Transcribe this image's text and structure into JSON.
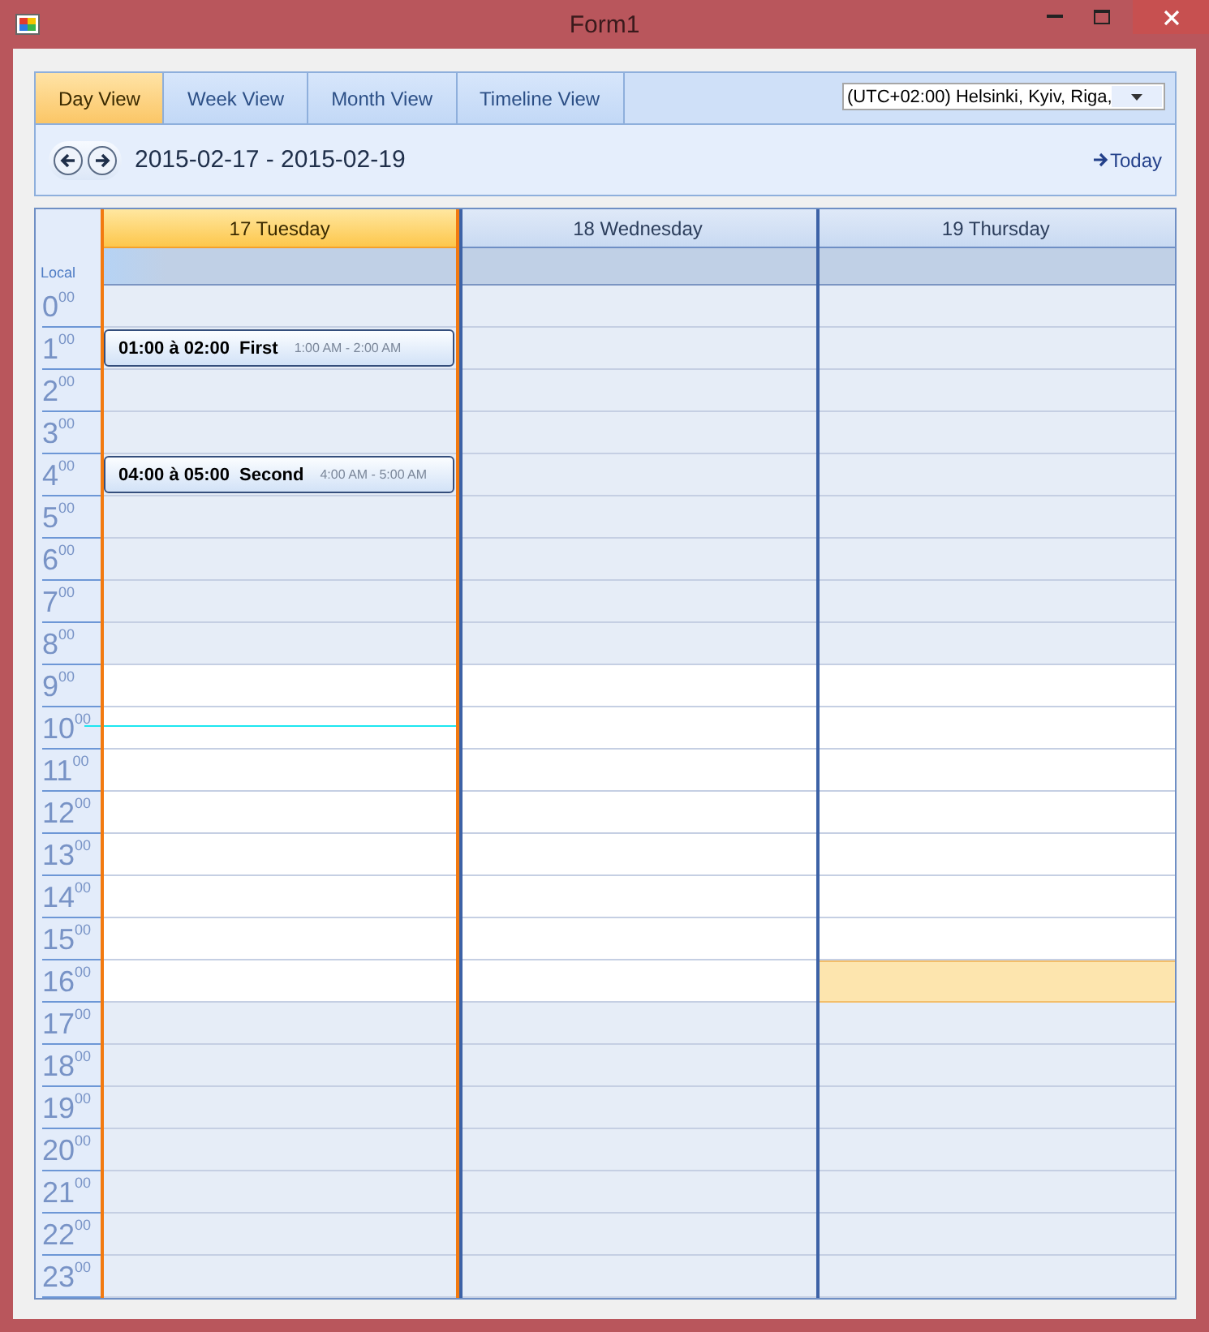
{
  "window": {
    "title": "Form1"
  },
  "tabs": [
    {
      "label": "Day View",
      "selected": true
    },
    {
      "label": "Week View",
      "selected": false
    },
    {
      "label": "Month View",
      "selected": false
    },
    {
      "label": "Timeline View",
      "selected": false
    }
  ],
  "timezone": {
    "value": "(UTC+02:00) Helsinki, Kyiv, Riga,"
  },
  "range": "2015-02-17 - 2015-02-19",
  "today_link": "Today",
  "time_column_label": "Local",
  "days": [
    {
      "label": "17 Tuesday",
      "selected": true,
      "today": true,
      "has_selected_slot": false
    },
    {
      "label": "18 Wednesday",
      "selected": false,
      "today": false,
      "has_selected_slot": false
    },
    {
      "label": "19 Thursday",
      "selected": false,
      "today": false,
      "has_selected_slot": true
    }
  ],
  "hours": [
    {
      "hour": "0",
      "minutes": "00",
      "work_hours": false,
      "now": false,
      "selected": false
    },
    {
      "hour": "1",
      "minutes": "00",
      "work_hours": false,
      "now": false,
      "selected": false,
      "appointments": [
        {
          "time": "01:00 à 02:00",
          "title": "First",
          "range": "1:00 AM - 2:00 AM"
        }
      ]
    },
    {
      "hour": "2",
      "minutes": "00",
      "work_hours": false,
      "now": false,
      "selected": false
    },
    {
      "hour": "3",
      "minutes": "00",
      "work_hours": false,
      "now": false,
      "selected": false
    },
    {
      "hour": "4",
      "minutes": "00",
      "work_hours": false,
      "now": false,
      "selected": false,
      "appointments": [
        {
          "time": "04:00 à 05:00",
          "title": "Second",
          "range": "4:00 AM - 5:00 AM"
        }
      ]
    },
    {
      "hour": "5",
      "minutes": "00",
      "work_hours": false,
      "now": false,
      "selected": false
    },
    {
      "hour": "6",
      "minutes": "00",
      "work_hours": false,
      "now": false,
      "selected": false
    },
    {
      "hour": "7",
      "minutes": "00",
      "work_hours": false,
      "now": false,
      "selected": false
    },
    {
      "hour": "8",
      "minutes": "00",
      "work_hours": false,
      "now": false,
      "selected": false
    },
    {
      "hour": "9",
      "minutes": "00",
      "work_hours": true,
      "now": false,
      "selected": false
    },
    {
      "hour": "10",
      "minutes": "00",
      "work_hours": true,
      "now": true,
      "selected": false
    },
    {
      "hour": "11",
      "minutes": "00",
      "work_hours": true,
      "now": false,
      "selected": false
    },
    {
      "hour": "12",
      "minutes": "00",
      "work_hours": true,
      "now": false,
      "selected": false
    },
    {
      "hour": "13",
      "minutes": "00",
      "work_hours": true,
      "now": false,
      "selected": false
    },
    {
      "hour": "14",
      "minutes": "00",
      "work_hours": true,
      "now": false,
      "selected": false
    },
    {
      "hour": "15",
      "minutes": "00",
      "work_hours": true,
      "now": false,
      "selected": false
    },
    {
      "hour": "16",
      "minutes": "00",
      "work_hours": true,
      "now": false,
      "selected": true
    },
    {
      "hour": "17",
      "minutes": "00",
      "work_hours": false,
      "now": false,
      "selected": false
    },
    {
      "hour": "18",
      "minutes": "00",
      "work_hours": false,
      "now": false,
      "selected": false
    },
    {
      "hour": "19",
      "minutes": "00",
      "work_hours": false,
      "now": false,
      "selected": false
    },
    {
      "hour": "20",
      "minutes": "00",
      "work_hours": false,
      "now": false,
      "selected": false
    },
    {
      "hour": "21",
      "minutes": "00",
      "work_hours": false,
      "now": false,
      "selected": false
    },
    {
      "hour": "22",
      "minutes": "00",
      "work_hours": false,
      "now": false,
      "selected": false
    },
    {
      "hour": "23",
      "minutes": "00",
      "work_hours": false,
      "now": false,
      "selected": false
    }
  ]
}
